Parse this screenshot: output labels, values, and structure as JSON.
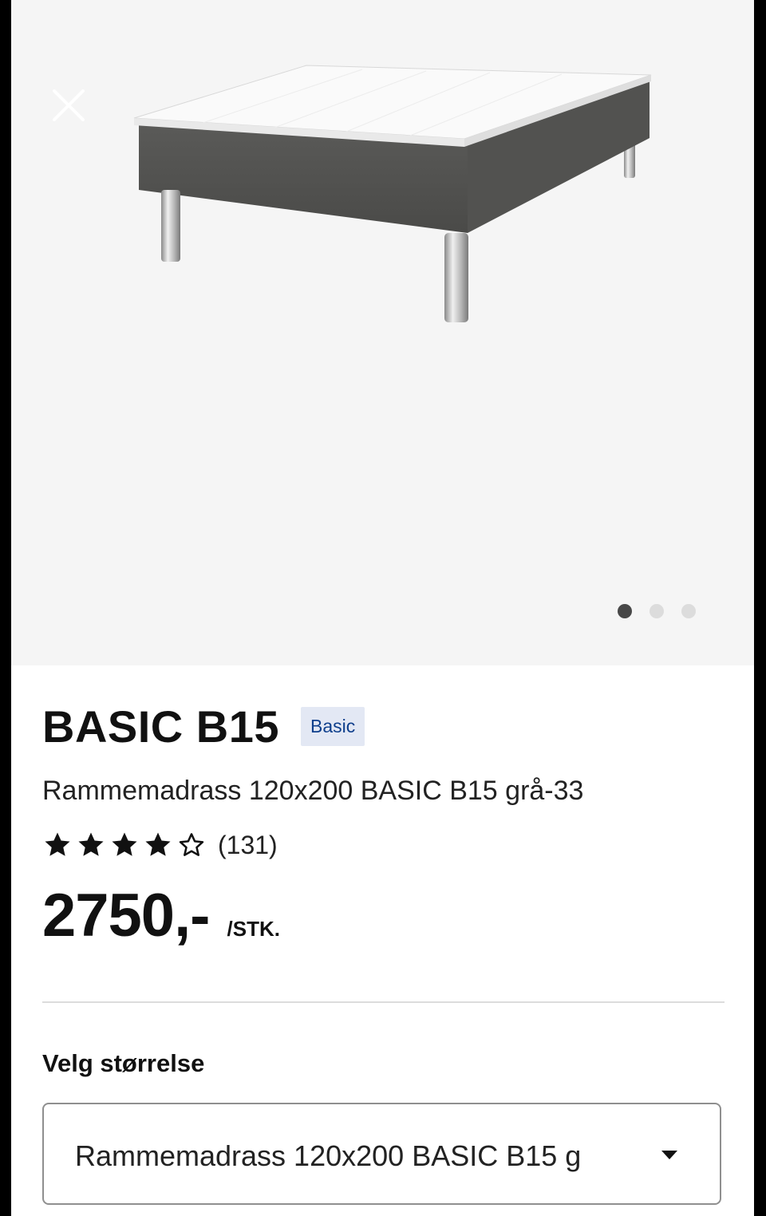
{
  "product": {
    "title": "BASIC B15",
    "badge": "Basic",
    "subtitle": "Rammemadrass 120x200 BASIC B15 grå-33",
    "rating": {
      "score": 4,
      "max": 5,
      "review_count": "(131)"
    },
    "price": "2750,-",
    "unit": "/STK."
  },
  "gallery": {
    "image_count": 3,
    "active_index": 0
  },
  "size_selector": {
    "label": "Velg størrelse",
    "value": "Rammemadrass 120x200 BASIC B15 g"
  },
  "colors": {
    "badge_bg": "#e3e8f4",
    "badge_text": "#0e3f8c",
    "gallery_bg": "#f5f5f5",
    "dot_active": "#484848",
    "dot_inactive": "#dcdcdc"
  },
  "icons": {
    "close": "close-icon",
    "dropdown": "chevron-down-icon",
    "star_filled": "star-filled-icon",
    "star_empty": "star-outline-icon"
  }
}
